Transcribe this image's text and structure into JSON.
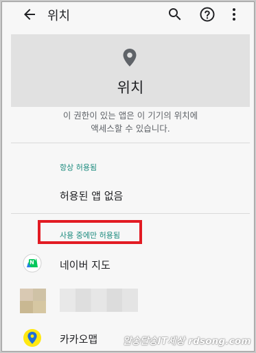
{
  "appbar": {
    "title": "위치",
    "icons": [
      "back-arrow-icon",
      "search-icon",
      "help-icon",
      "more-vert-icon"
    ]
  },
  "hero": {
    "icon": "location-pin-icon",
    "title": "위치"
  },
  "description": {
    "line1": "이 권한이 있는 앱은 이 기기의 위치에",
    "line2": "액세스할 수 있습니다."
  },
  "sections": {
    "always": {
      "label": "항상 허용됨",
      "empty": "허용된 앱 없음"
    },
    "while_in_use": {
      "label": "사용 중에만 허용됨",
      "apps": [
        {
          "name": "네이버 지도",
          "icon": "naver-map-icon"
        },
        {
          "name": "",
          "icon": "blurred-app-icon"
        },
        {
          "name": "카카오맵",
          "icon": "kakaomap-icon"
        }
      ]
    }
  },
  "colors": {
    "accent": "#1a8a7d",
    "highlight": "#e21b23",
    "hero_bg": "#e1e1e1"
  },
  "watermark": "알송달송IT세상 rdsong.com"
}
